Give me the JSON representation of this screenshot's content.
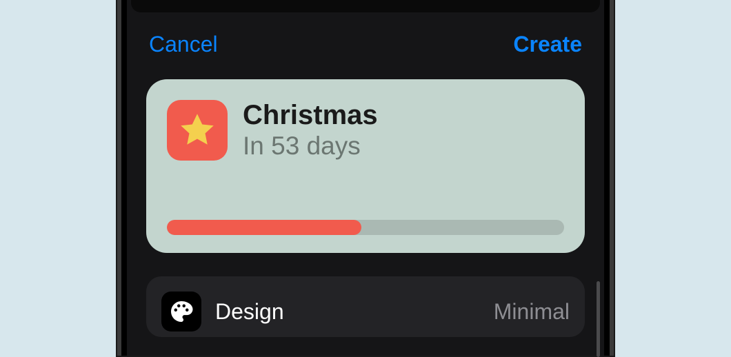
{
  "nav": {
    "cancel": "Cancel",
    "create": "Create"
  },
  "preview": {
    "title": "Christmas",
    "subtitle": "In 53 days",
    "icon_color": "#f15b4d",
    "star_color": "#f4d04e",
    "progress_pct": 49
  },
  "settings": {
    "design": {
      "label": "Design",
      "value": "Minimal"
    }
  }
}
